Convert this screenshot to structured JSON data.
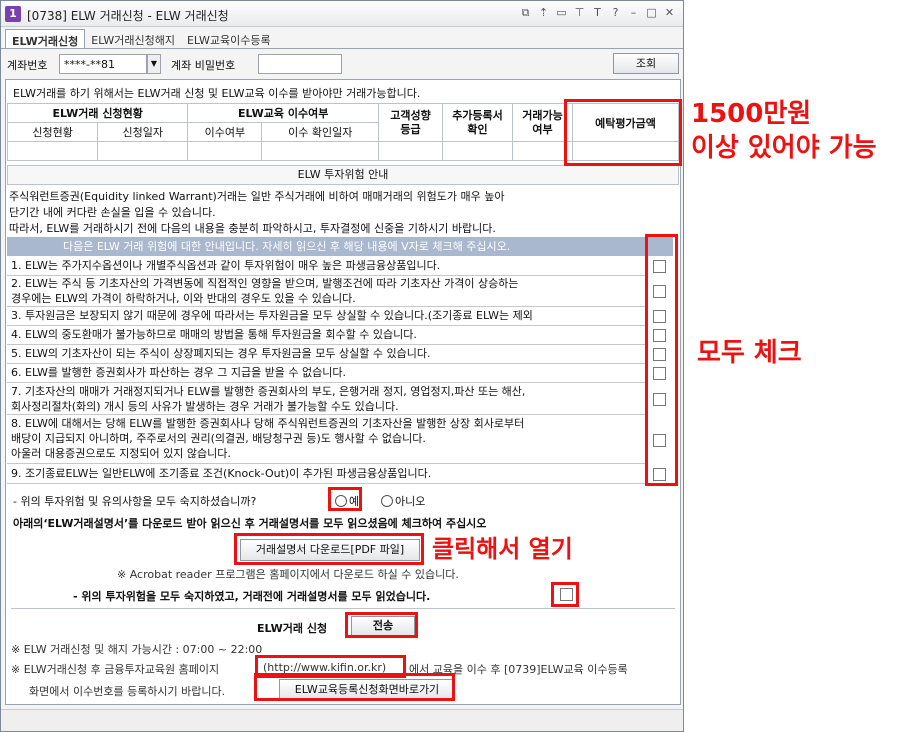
{
  "window": {
    "app_icon": "1",
    "title": "[0738] ELW 거래신청 - ELW 거래신청",
    "title_icons": [
      "restore-icon",
      "pin-icon",
      "minimize-to-tray-icon",
      "tack-icon",
      "font-size-icon",
      "help-icon",
      "minimize-icon",
      "maximize-icon",
      "close-icon"
    ],
    "title_glyphs": [
      "⧉",
      "⇡",
      "▭",
      "⊤",
      "T",
      "?",
      "–",
      "□",
      "✕"
    ]
  },
  "tabs": [
    "ELW거래신청",
    "ELW거래신청해지",
    "ELW교육이수등록"
  ],
  "account": {
    "label": "계좌번호",
    "value": "****-**81",
    "password_label": "계좌 비밀번호",
    "password_value": "",
    "query_button": "조회"
  },
  "requirement_text": "ELW거래를 하기 위해서는   ELW거래 신청 및 ELW교육 이수를 받아야만 거래가능합니다.",
  "status_table": {
    "group_apply": "ELW거래 신청현황",
    "group_edu": "ELW교육 이수여부",
    "apply_status": "신청현황",
    "apply_date": "신청일자",
    "edu_status": "이수여부",
    "edu_confirm_date": "이수 확인일자",
    "risk_grade": "고객성향\n등급",
    "extra_reg": "추가등록서\n확인",
    "tradable": "거래가능\n여부",
    "deposit_eval": "예탁평가금액"
  },
  "risk_section": {
    "title": "ELW 투자위험 안내",
    "intro": [
      "주식워런트증권(Equidity linked Warrant)거래는 일반 주식거래에 비하여 매매거래의 위험도가 매우 높아",
      "단기간 내에 커다란 손실을 입을 수 있습니다.",
      "따라서, ELW를 거래하시기 전에 다음의 내용을 충분히 파악하시고, 투자결정에 신중을 기하시기 바랍니다."
    ],
    "header": "다음은 ELW 거래 위험에 대한 안내입니다. 자세히 읽으신 후 해당 내용에 V자로 체크해 주십시오.",
    "items": [
      "1. ELW는 주가지수옵션이나 개별주식옵션과 같이 투자위험이 매우 높은 파생금융상품입니다.",
      "2. ELW는 주식 등 기초자산의 가격변동에 직접적인 영향을 받으며, 발행조건에 따라 기초자산 가격이 상승하는\n    경우에는 ELW의 가격이 하락하거나, 이와 반대의 경우도 있을 수 있습니다.",
      "3. 투자원금은 보장되지 않기 때문에 경우에 따라서는 투자원금을 모두 상실할 수 있습니다.(조기종료 ELW는 제외",
      "4. ELW의 중도환매가 불가능하므로 매매의 방법을 통해 투자원금을 회수할 수 있습니다.",
      "5. ELW의 기초자산이 되는 주식이 상장폐지되는 경우 투자원금을 모두 상실할 수 있습니다.",
      "6. ELW를 발행한 증권회사가 파산하는 경우 그 지급을 받을 수 없습니다.",
      "7. 기초자산의 매매가 거래정지되거나 ELW를 발행한 증권회사의 부도, 은행거래 정지, 영업정지,파산 또는 해산,\n    회사정리절차(화의) 개시 등의 사유가 발생하는 경우 거래가 불가능할 수도 있습니다.",
      "8. ELW에 대해서는 당해 ELW를 발행한 증권회사나 당해 주식워런트증권의 기초자산을 발행한 상장 회사로부터\n    배당이 지급되지 아니하며, 주주로서의 권리(의결권, 배당청구권 등)도 행사할 수 없습니다.\n    아울러 대용증권으로도 지정되어 있지 않습니다.",
      "9. 조기종료ELW는 일반ELW에 조기종료 조건(Knock-Out)이 추가된 파생금융상품입니다."
    ]
  },
  "acknowledge": {
    "question": "- 위의 투자위험 및 유의사항을 모두 숙지하셨습니까?",
    "yes": "예",
    "no": "아니오"
  },
  "download": {
    "instruction": "아래의‘ELW거래설명서’를 다운로드 받아 읽으신 후 거래설명서를 모두 읽으셨음에 체크하여 주십시오",
    "button": "거래설명서 다운로드[PDF 파일]",
    "acrobat_note": "※ Acrobat reader 프로그램은 홈페이지에서 다운로드 하실 수 있습니다.",
    "confirm_text": "- 위의 투자위험을 모두 숙지하였고, 거래전에 거래설명서를 모두 읽었습니다."
  },
  "submit": {
    "label": "ELW거래 신청",
    "button": "전송"
  },
  "footer": {
    "hours": "※ ELW 거래신청 및 해지 가능시간 : 07:00 ~ 22:00",
    "edu_prefix": "※ ELW거래신청 후 금융투자교육원 홈페이지",
    "edu_url": "(http://www.kifin.or.kr)",
    "edu_suffix": "에서 교육을 이수 후 [0739]ELW교육 이수등록",
    "edu_line2": "화면에서 이수번호를 등록하시기 바랍니다.",
    "shortcut_button": "ELW교육등록신청화면바로가기"
  },
  "annotations": {
    "deposit_line1": "1500만원",
    "deposit_line2": "이상 있어야 가능",
    "check_all": "모두 체크",
    "click_open": "클릭해서 열기",
    "color": "#ee1111"
  }
}
